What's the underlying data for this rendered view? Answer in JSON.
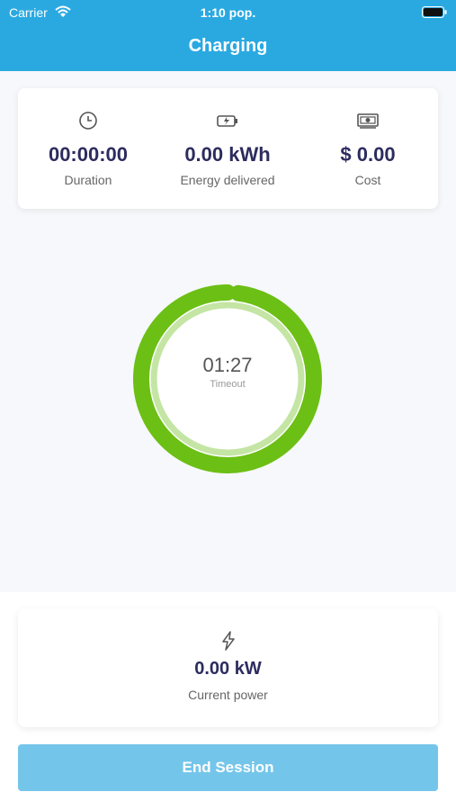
{
  "status_bar": {
    "carrier": "Carrier",
    "time": "1:10 pop."
  },
  "header": {
    "title": "Charging"
  },
  "stats": [
    {
      "icon": "clock-icon",
      "value": "00:00:00",
      "label": "Duration"
    },
    {
      "icon": "battery-charging-icon",
      "value": "0.00 kWh",
      "label": "Energy delivered"
    },
    {
      "icon": "money-icon",
      "value": "$ 0.00",
      "label": "Cost"
    }
  ],
  "timer": {
    "value": "01:27",
    "label": "Timeout",
    "progress_fraction": 0.98
  },
  "power": {
    "icon": "bolt-icon",
    "value": "0.00 kW",
    "label": "Current power"
  },
  "actions": {
    "end_session_label": "End Session"
  },
  "colors": {
    "header": "#2aa9e1",
    "ring_outer": "#6cbf14",
    "ring_inner": "#c4e5a4",
    "button": "#74c5ea",
    "value_text": "#2c2c5e"
  }
}
